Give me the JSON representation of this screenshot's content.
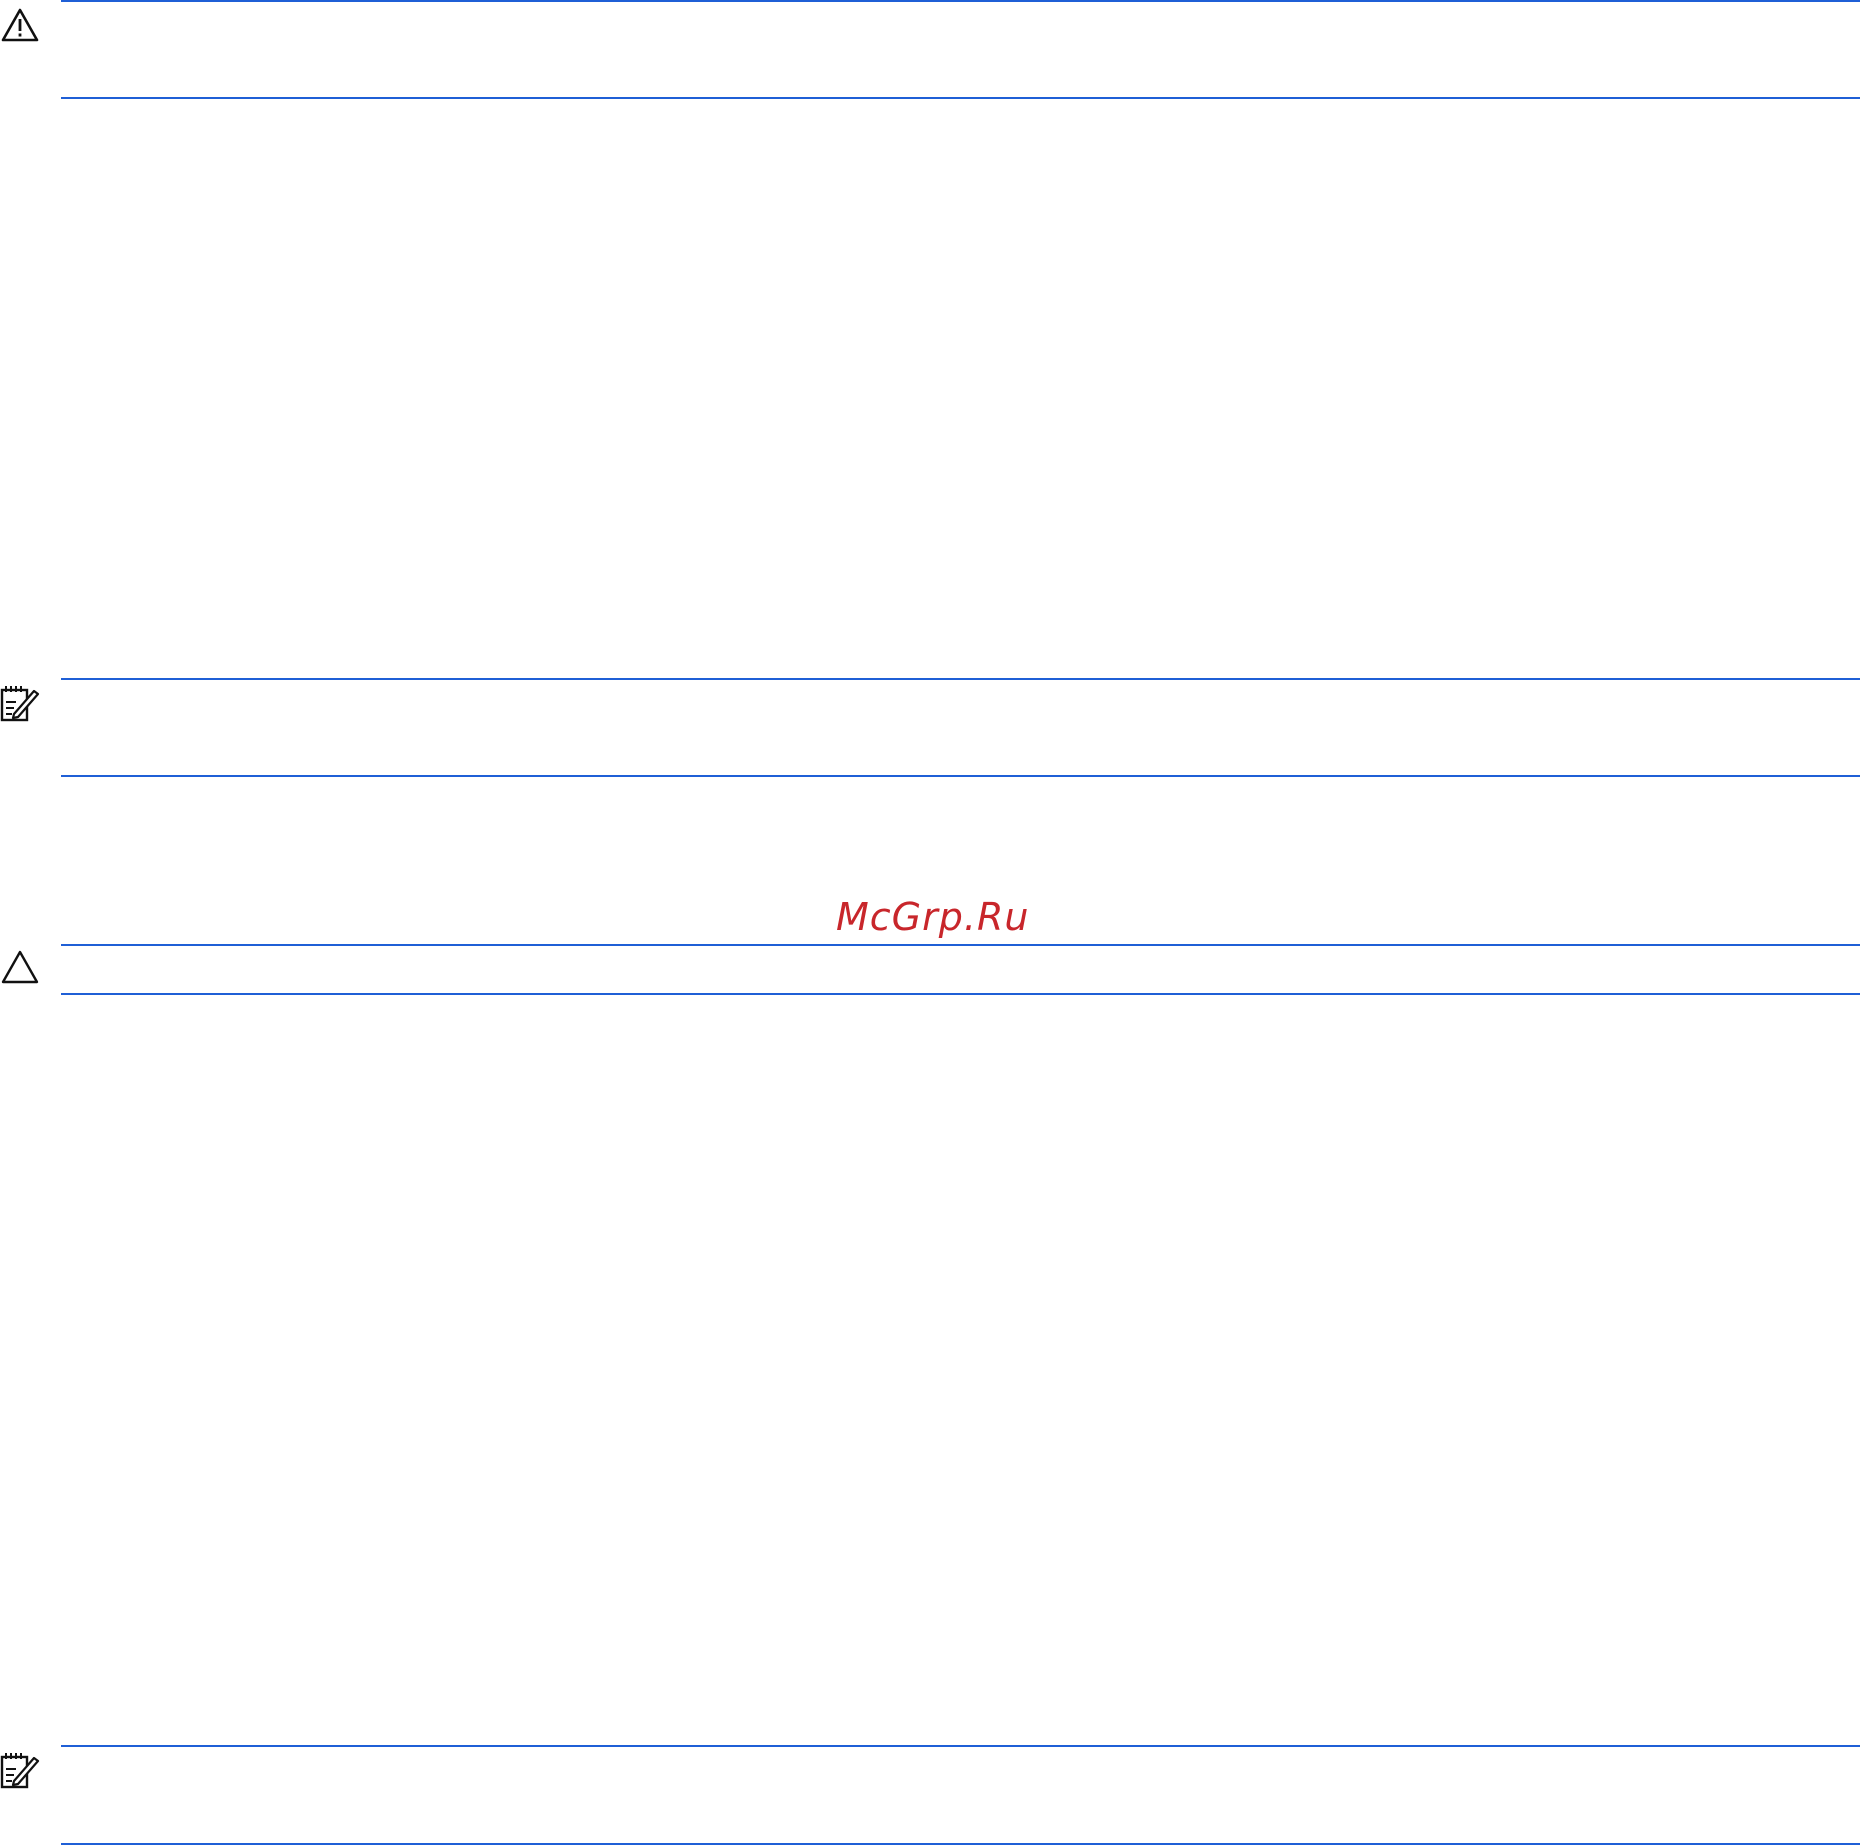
{
  "page": {
    "rule_color": "#1f5fd6",
    "watermark_color": "#c8262b"
  },
  "watermark": {
    "text": "McGrp.Ru"
  },
  "notices": [
    {
      "kind": "warning",
      "icon": "warning-icon"
    },
    {
      "kind": "note",
      "icon": "note-icon"
    },
    {
      "kind": "caution",
      "icon": "caution-icon"
    },
    {
      "kind": "note",
      "icon": "note-icon"
    }
  ]
}
